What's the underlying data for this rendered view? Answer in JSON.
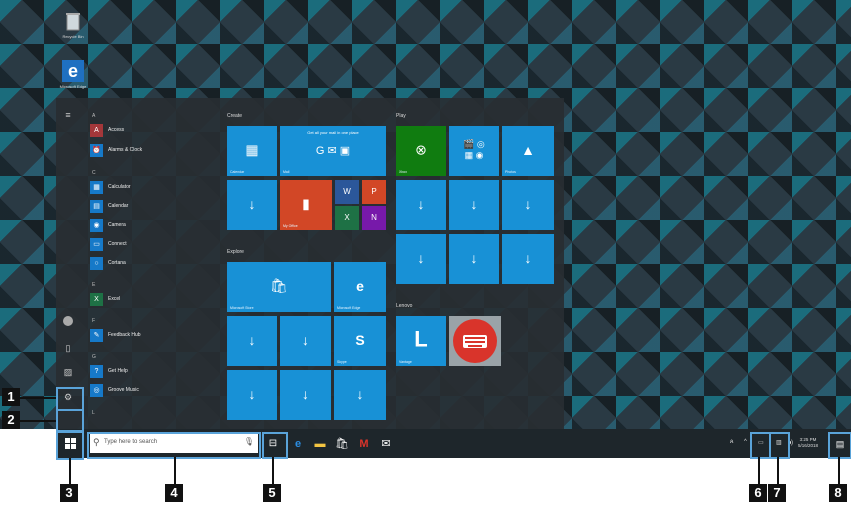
{
  "desktop": {
    "icons": [
      {
        "name": "recycle-bin-icon",
        "label": "Recycle Bin"
      },
      {
        "name": "edge-icon",
        "label": "Microsoft Edge"
      }
    ]
  },
  "start_menu": {
    "rail": [
      "hamburger-icon",
      "user-icon",
      "documents-icon",
      "pictures-icon",
      "settings-icon",
      "power-icon"
    ],
    "apps": [
      {
        "header": "A"
      },
      {
        "label": "Access",
        "icon": "A"
      },
      {
        "label": "Alarms & Clock",
        "icon": "⏰"
      },
      {
        "header": "C"
      },
      {
        "label": "Calculator",
        "icon": "▦"
      },
      {
        "label": "Calendar",
        "icon": "▤"
      },
      {
        "label": "Camera",
        "icon": "◉"
      },
      {
        "label": "Connect",
        "icon": "▭"
      },
      {
        "label": "Cortana",
        "icon": "○"
      },
      {
        "header": "E"
      },
      {
        "label": "Excel",
        "icon": "X"
      },
      {
        "header": "F"
      },
      {
        "label": "Feedback Hub",
        "icon": "✎"
      },
      {
        "header": "G"
      },
      {
        "label": "Get Help",
        "icon": "?"
      },
      {
        "label": "Groove Music",
        "icon": "◎"
      },
      {
        "header": "L"
      }
    ],
    "groups": {
      "create": "Create",
      "explore": "Explore",
      "play": "Play",
      "lenovo": "Lenovo"
    },
    "tiles": {
      "calendar": "Calendar",
      "mail": "Mail",
      "mail_banner": "Get all your mail in one place",
      "my_office": "My Office",
      "store": "Microsoft Store",
      "edge": "Microsoft Edge",
      "skype": "Skype",
      "xbox": "Xbox",
      "photos": "Photos",
      "vantage": "Vantage"
    }
  },
  "taskbar": {
    "search_placeholder": "Type here to search",
    "clock_time": "3:25 PM",
    "clock_date": "5/16/2018"
  },
  "callouts": [
    "1",
    "2",
    "3",
    "4",
    "5",
    "6",
    "7",
    "8"
  ],
  "colors": {
    "tile_blue": "#1891d6",
    "xbox_green": "#107c10",
    "office_orange": "#d24726",
    "taskbar": "#1e262b",
    "callout_box": "#5aa3d9"
  }
}
